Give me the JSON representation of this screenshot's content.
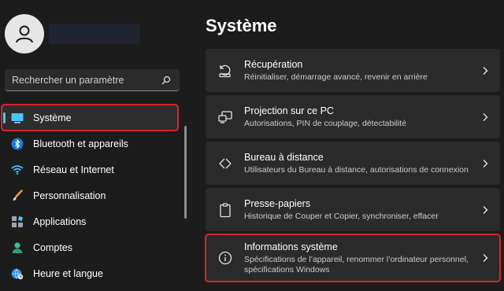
{
  "sidebar": {
    "search": {
      "placeholder": "Rechercher un paramètre"
    },
    "items": [
      {
        "label": "Système",
        "icon": "monitor-icon",
        "active": true
      },
      {
        "label": "Bluetooth et appareils",
        "icon": "bluetooth-icon"
      },
      {
        "label": "Réseau et Internet",
        "icon": "wifi-icon"
      },
      {
        "label": "Personnalisation",
        "icon": "brush-icon"
      },
      {
        "label": "Applications",
        "icon": "apps-icon"
      },
      {
        "label": "Comptes",
        "icon": "account-icon"
      },
      {
        "label": "Heure et langue",
        "icon": "globe-clock-icon"
      }
    ]
  },
  "main": {
    "title": "Système",
    "cards": [
      {
        "title": "Récupération",
        "desc": "Réinitialiser, démarrage avancé, revenir en arrière",
        "icon": "recovery-icon"
      },
      {
        "title": "Projection sur ce PC",
        "desc": "Autorisations, PIN de couplage, détectabilité",
        "icon": "projection-icon"
      },
      {
        "title": "Bureau à distance",
        "desc": "Utilisateurs du Bureau à distance, autorisations de connexion",
        "icon": "remote-desktop-icon"
      },
      {
        "title": "Presse-papiers",
        "desc": "Historique de Couper et Copier, synchroniser, effacer",
        "icon": "clipboard-icon"
      },
      {
        "title": "Informations système",
        "desc": "Spécifications de l’appareil, renommer l’ordinateur personnel, spécifications Windows",
        "icon": "info-icon"
      }
    ]
  },
  "colors": {
    "accent": "#4cc2ff",
    "highlight": "#d8242e",
    "background": "#1c1c1c",
    "card": "#2b2b2b"
  }
}
